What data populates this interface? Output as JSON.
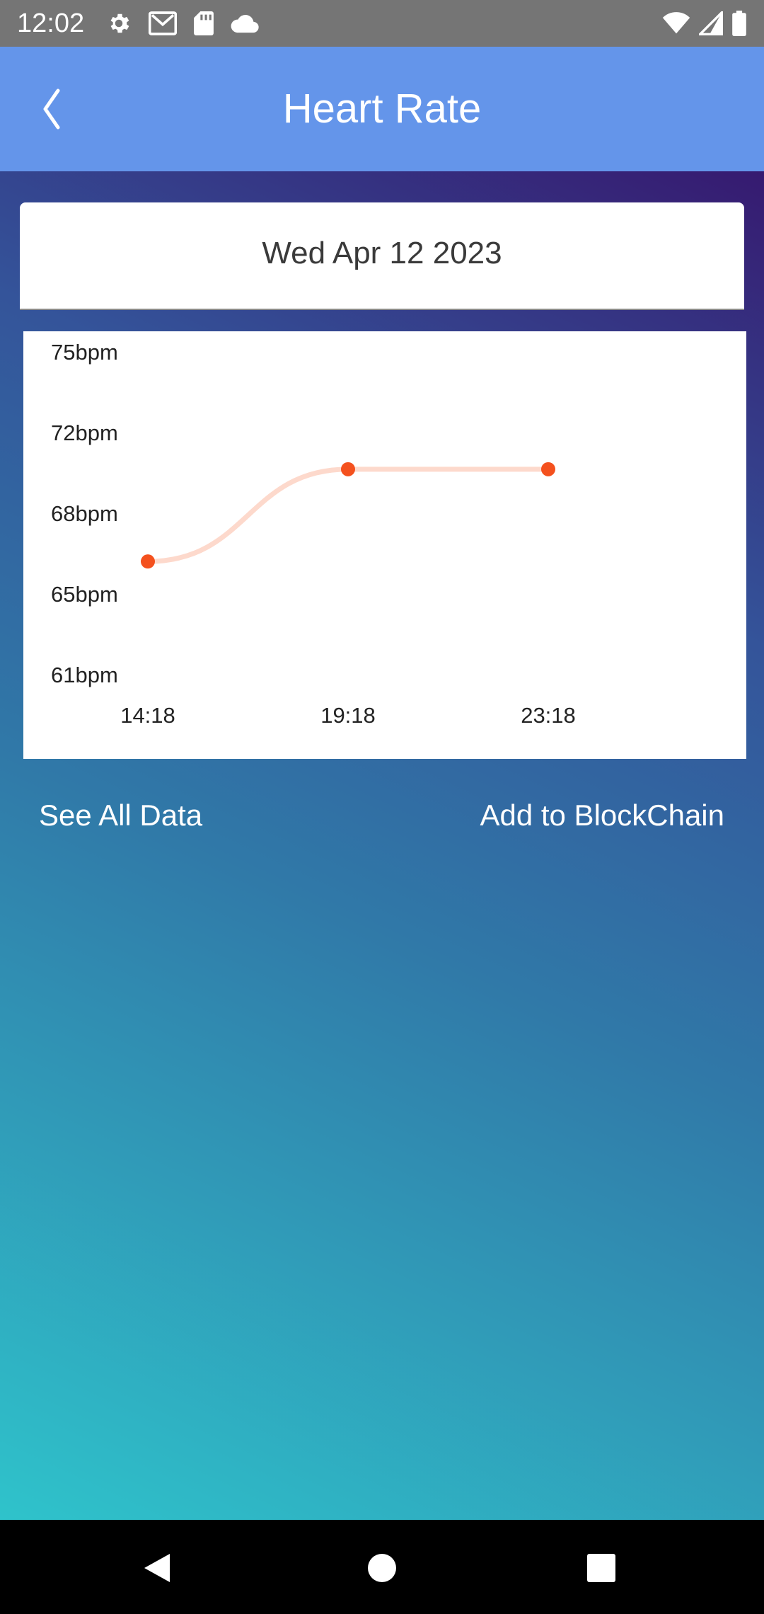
{
  "status_bar": {
    "time": "12:02",
    "left_icons": [
      "settings-icon",
      "gmail-icon",
      "sd-card-icon",
      "cloud-icon"
    ],
    "right_icons": [
      "wifi-icon",
      "signal-icon",
      "battery-icon"
    ]
  },
  "app_bar": {
    "title": "Heart Rate",
    "back_icon": "chevron-left-icon",
    "color": "#6495ea"
  },
  "date_card": {
    "date": "Wed Apr 12 2023"
  },
  "chart_data": {
    "type": "line",
    "title": "",
    "xlabel": "",
    "ylabel": "",
    "x": [
      "14:18",
      "19:18",
      "23:18"
    ],
    "y_ticks": [
      "75bpm",
      "72bpm",
      "68bpm",
      "65bpm",
      "61bpm"
    ],
    "ylim": [
      61,
      75
    ],
    "series": [
      {
        "values": [
          66,
          70,
          70
        ]
      }
    ],
    "line_color": "#fdd9cc",
    "point_color": "#f4511e",
    "grid": false,
    "legend": "none"
  },
  "actions": {
    "see_all": "See All Data",
    "add_blockchain": "Add to BlockChain"
  },
  "nav_bar": {
    "icons": [
      "nav-back-icon",
      "nav-home-icon",
      "nav-recents-icon"
    ]
  }
}
